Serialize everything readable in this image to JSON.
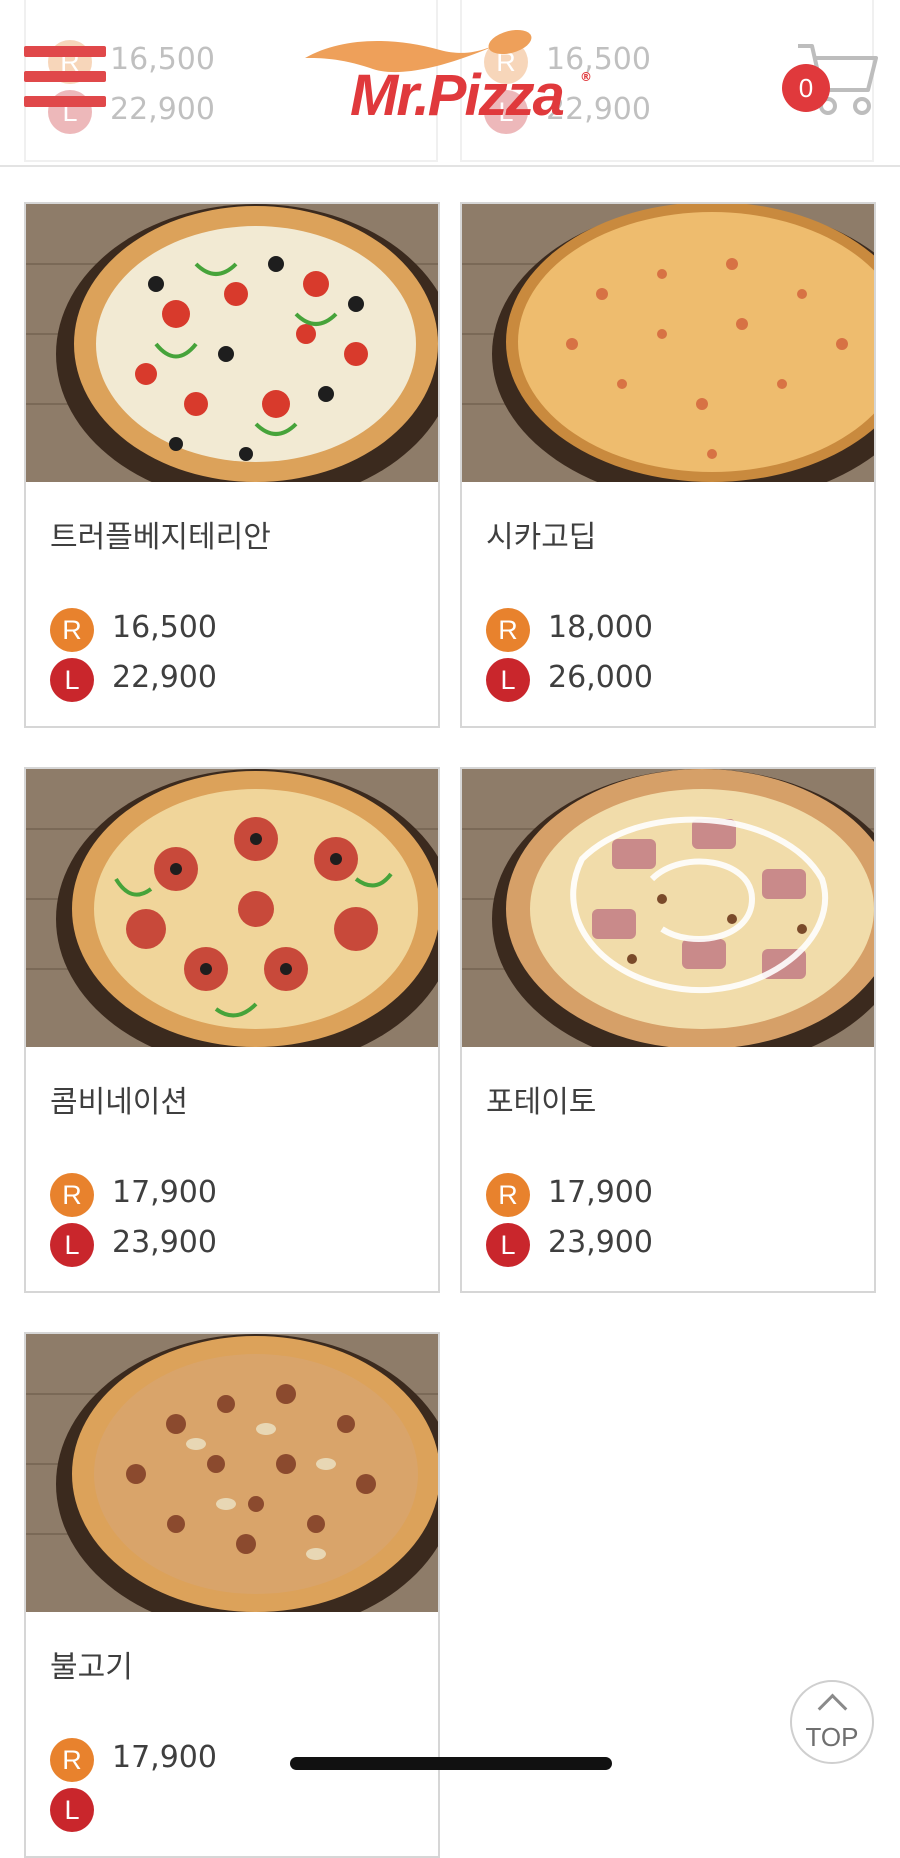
{
  "header": {
    "logo_text": "Mr.Pizza",
    "logo_mark": "®",
    "cart_count": "0",
    "ghost_prices": [
      {
        "r": "16,500",
        "l": "22,900"
      },
      {
        "r": "16,500",
        "l": "22,900"
      }
    ]
  },
  "badges": {
    "regular": "R",
    "large": "L"
  },
  "products": [
    {
      "name": "트러플베지테리안",
      "price_r": "16,500",
      "price_l": "22,900"
    },
    {
      "name": "시카고딥",
      "price_r": "18,000",
      "price_l": "26,000"
    },
    {
      "name": "콤비네이션",
      "price_r": "17,900",
      "price_l": "23,900"
    },
    {
      "name": "포테이토",
      "price_r": "17,900",
      "price_l": "23,900"
    },
    {
      "name": "불고기",
      "price_r": "17,900",
      "price_l": ""
    }
  ],
  "top_button": {
    "label": "TOP"
  },
  "colors": {
    "brand": "#e0393c",
    "regular_badge": "#e8822d",
    "large_badge": "#c9262c",
    "wood": "#8e7c69",
    "crust": "#d99a4e"
  }
}
